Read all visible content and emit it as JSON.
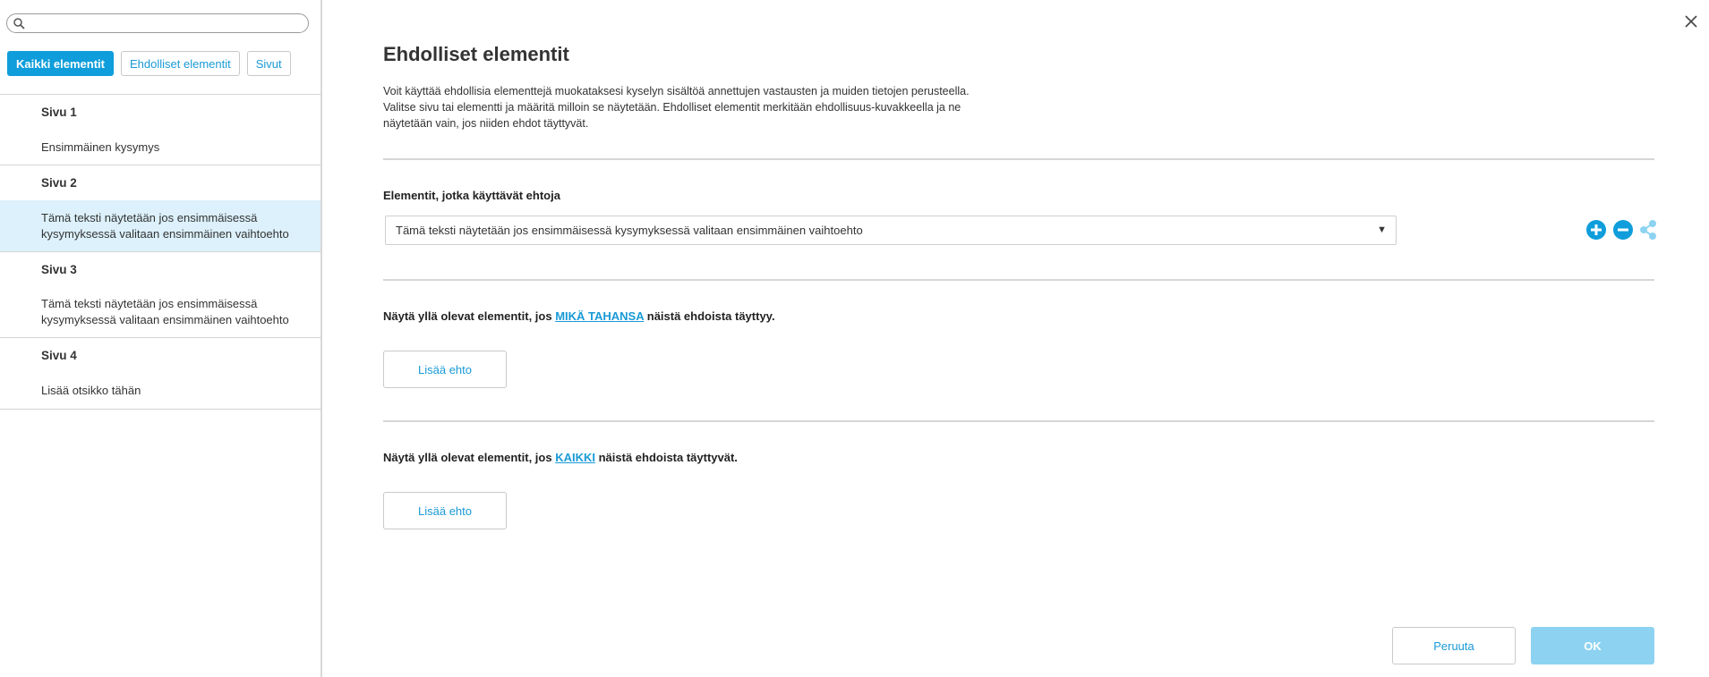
{
  "search": {
    "placeholder": "",
    "value": ""
  },
  "filters": [
    {
      "label": "Kaikki elementit",
      "active": true
    },
    {
      "label": "Ehdolliset elementit",
      "active": false
    },
    {
      "label": "Sivut",
      "active": false
    }
  ],
  "nav": [
    {
      "type": "page",
      "label": "Sivu 1"
    },
    {
      "type": "item",
      "lines": [
        "Ensimmäinen kysymys"
      ]
    },
    {
      "type": "page",
      "label": "Sivu 2"
    },
    {
      "type": "item",
      "selected": true,
      "lines": [
        "Tämä teksti näytetään jos ensimmäisessä",
        "kysymyksessä valitaan ensimmäinen vaihtoehto"
      ]
    },
    {
      "type": "page",
      "label": "Sivu 3"
    },
    {
      "type": "item",
      "lines": [
        "Tämä teksti näytetään jos ensimmäisessä",
        "kysymyksessä valitaan ensimmäinen vaihtoehto"
      ]
    },
    {
      "type": "page",
      "label": "Sivu 4"
    },
    {
      "type": "item",
      "lines": [
        "Lisää otsikko tähän"
      ]
    }
  ],
  "main": {
    "title": "Ehdolliset elementit",
    "description": [
      "Voit käyttää ehdollisia elementtejä muokataksesi kyselyn sisältöä annettujen vastausten ja muiden tietojen perusteella.",
      "Valitse sivu tai elementti ja määritä milloin se näytetään. Ehdolliset elementit merkitään ehdollisuus-kuvakkeella ja ne",
      "näytetään vain, jos niiden ehdot täyttyvät."
    ],
    "elements_label": "Elementit, jotka käyttävät ehtoja",
    "selected_element": "Tämä teksti näytetään jos ensimmäisessä kysymyksessä valitaan ensimmäinen vaihtoehto",
    "any_section": {
      "prefix": "Näytä yllä olevat elementit, jos ",
      "link": "MIKÄ TAHANSA",
      "suffix": " näistä ehdoista täyttyy."
    },
    "all_section": {
      "prefix": "Näytä yllä olevat elementit, jos ",
      "link": "KAIKKI",
      "suffix": " näistä ehdoista täyttyvät."
    },
    "add_condition_label": "Lisää ehto"
  },
  "footer": {
    "cancel_label": "Peruuta",
    "ok_label": "OK"
  },
  "colors": {
    "accent": "#0f9edb",
    "link": "#1a9ad6",
    "selected_bg": "#dcf1fb",
    "ok_disabled": "#8dd3f1"
  }
}
